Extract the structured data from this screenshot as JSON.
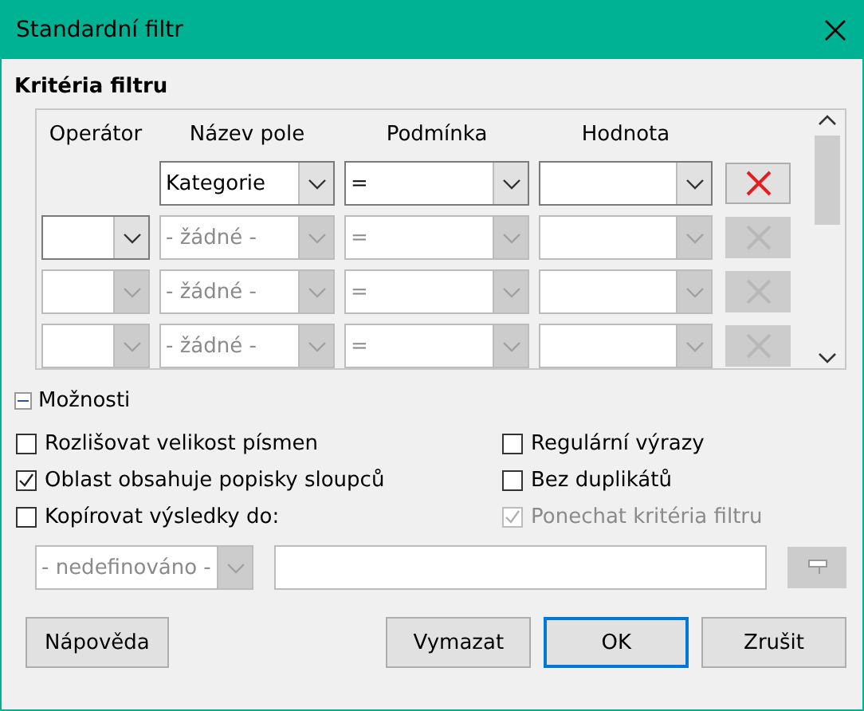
{
  "window": {
    "title": "Standardní filtr"
  },
  "criteria": {
    "title": "Kritéria filtru",
    "columns": [
      "Operátor",
      "Název pole",
      "Podmínka",
      "Hodnota"
    ],
    "rows": [
      {
        "field": {
          "value": "Kategorie",
          "disabled": false
        },
        "condition": {
          "value": "=",
          "disabled": false
        },
        "value": {
          "disabled": false
        },
        "remove": {
          "disabled": false
        }
      },
      {
        "operator": {
          "disabled": false
        },
        "field": {
          "value": "- žádné -",
          "disabled": true
        },
        "condition": {
          "value": "=",
          "disabled": true
        },
        "value": {
          "disabled": true
        },
        "remove": {
          "disabled": true
        }
      },
      {
        "operator": {
          "disabled": true
        },
        "field": {
          "value": "- žádné -",
          "disabled": true
        },
        "condition": {
          "value": "=",
          "disabled": true
        },
        "value": {
          "disabled": true
        },
        "remove": {
          "disabled": true
        }
      },
      {
        "operator": {
          "disabled": true
        },
        "field": {
          "value": "- žádné -",
          "disabled": true
        },
        "condition": {
          "value": "=",
          "disabled": true
        },
        "value": {
          "disabled": true
        },
        "remove": {
          "disabled": true
        }
      }
    ]
  },
  "options": {
    "label": "Možnosti",
    "expanded": true,
    "checkboxes": [
      {
        "label": "Rozlišovat velikost písmen",
        "checked": false,
        "disabled": false
      },
      {
        "label": "Regulární výrazy",
        "checked": false,
        "disabled": false
      },
      {
        "label": "Oblast obsahuje popisky sloupců",
        "checked": true,
        "disabled": false
      },
      {
        "label": "Bez duplikátů",
        "checked": false,
        "disabled": false
      },
      {
        "label": "Kopírovat výsledky do:",
        "checked": false,
        "disabled": false
      },
      {
        "label": "Ponechat kritéria filtru",
        "checked": true,
        "disabled": true
      }
    ],
    "copy_target": {
      "combo": {
        "value": "- nedefinováno -",
        "disabled": true
      },
      "shrink": {
        "disabled": true
      }
    }
  },
  "buttons": [
    {
      "label": "Nápověda",
      "default": false
    },
    {
      "label": "Vymazat",
      "default": false
    },
    {
      "label": "OK",
      "default": true
    },
    {
      "label": "Zrušit",
      "default": false
    }
  ]
}
